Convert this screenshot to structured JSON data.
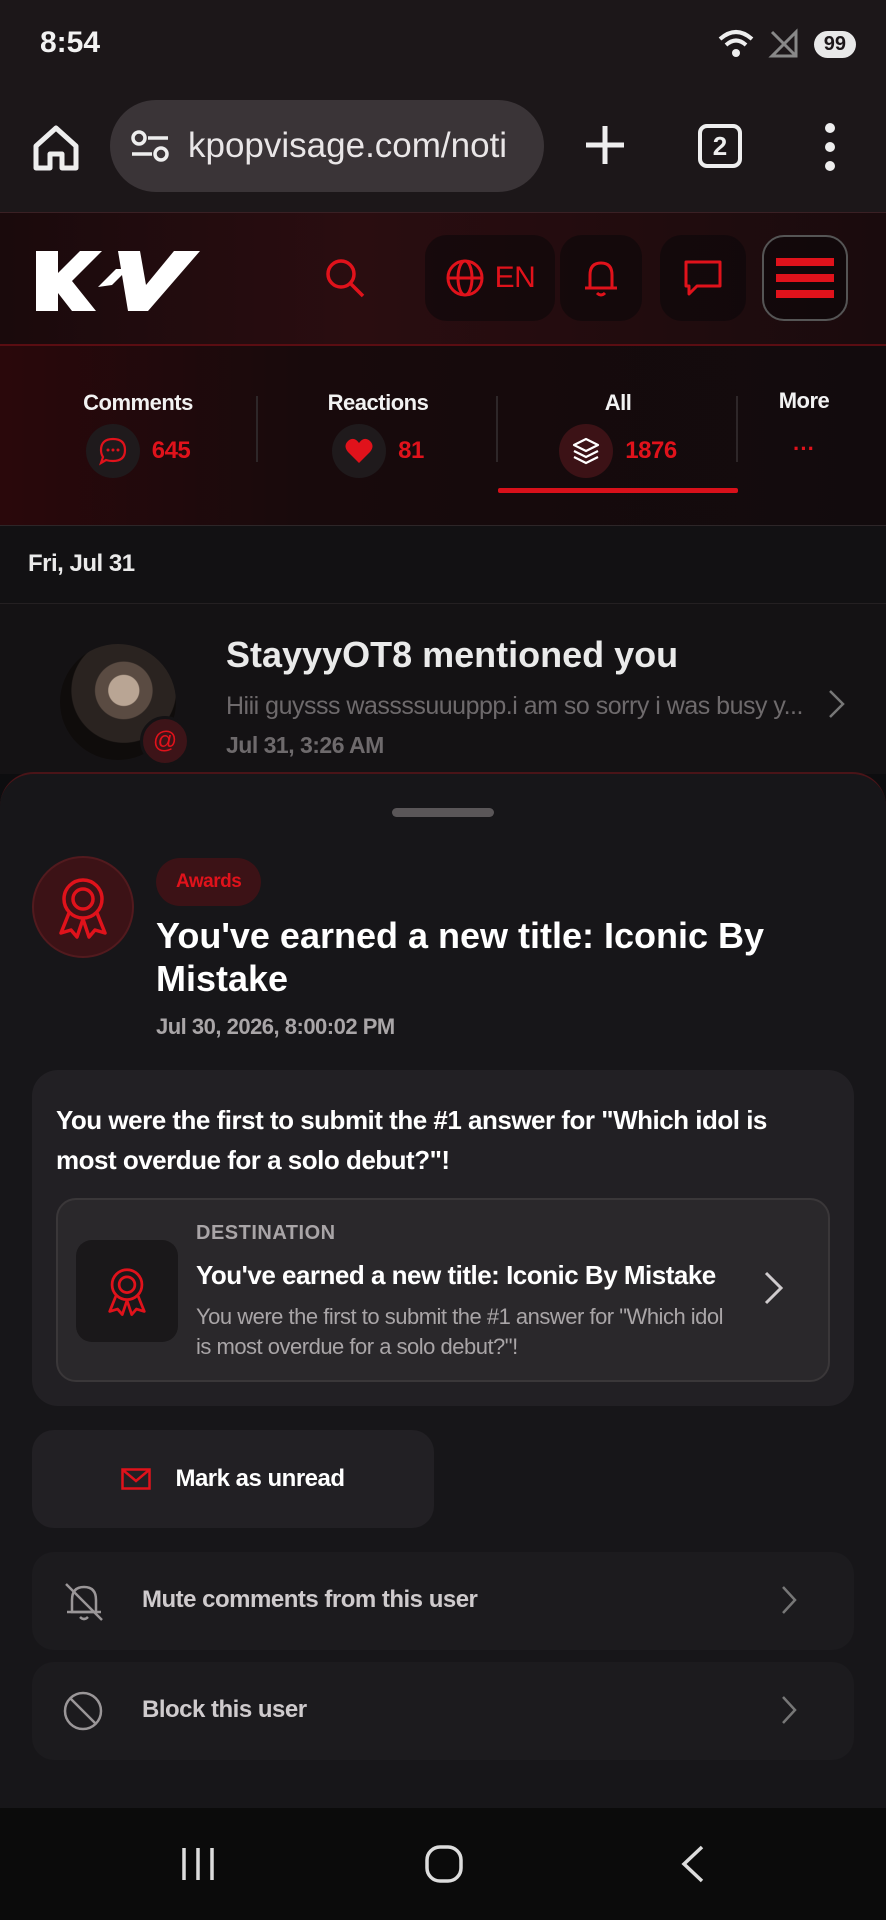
{
  "status_bar": {
    "time": "8:54",
    "battery": "99"
  },
  "browser": {
    "url": "kpopvisage.com/noti",
    "tab_count": "2"
  },
  "site_header": {
    "language": "EN"
  },
  "tabs": [
    {
      "label": "Comments",
      "count": "645"
    },
    {
      "label": "Reactions",
      "count": "81"
    },
    {
      "label": "All",
      "count": "1876",
      "active": true
    },
    {
      "label": "More",
      "count": "···"
    }
  ],
  "date_group": "Fri, Jul 31",
  "notification": {
    "title": "StayyyOT8 mentioned you",
    "snippet": "Hiii guysss wassssuuuppp.i am so sorry i was busy y...",
    "time": "Jul 31, 3:26 AM"
  },
  "sheet": {
    "tag": "Awards",
    "title": "You've earned a new title: Iconic By Mistake",
    "date": "Jul 30, 2026, 8:00:02 PM",
    "description": "You were the first to submit the #1 answer for \"Which idol is most overdue for a solo debut?\"!",
    "destination": {
      "label": "DESTINATION",
      "title": "You've earned a new title: Iconic By Mistake",
      "subtitle": "You were the first to submit the #1 answer for \"Which idol is most overdue for a solo debut?\"!"
    },
    "mark_unread": "Mark as unread",
    "mute_label": "Mute comments from this user",
    "block_label": "Block this user"
  },
  "colors": {
    "accent": "#e0121b",
    "background": "#171619"
  }
}
